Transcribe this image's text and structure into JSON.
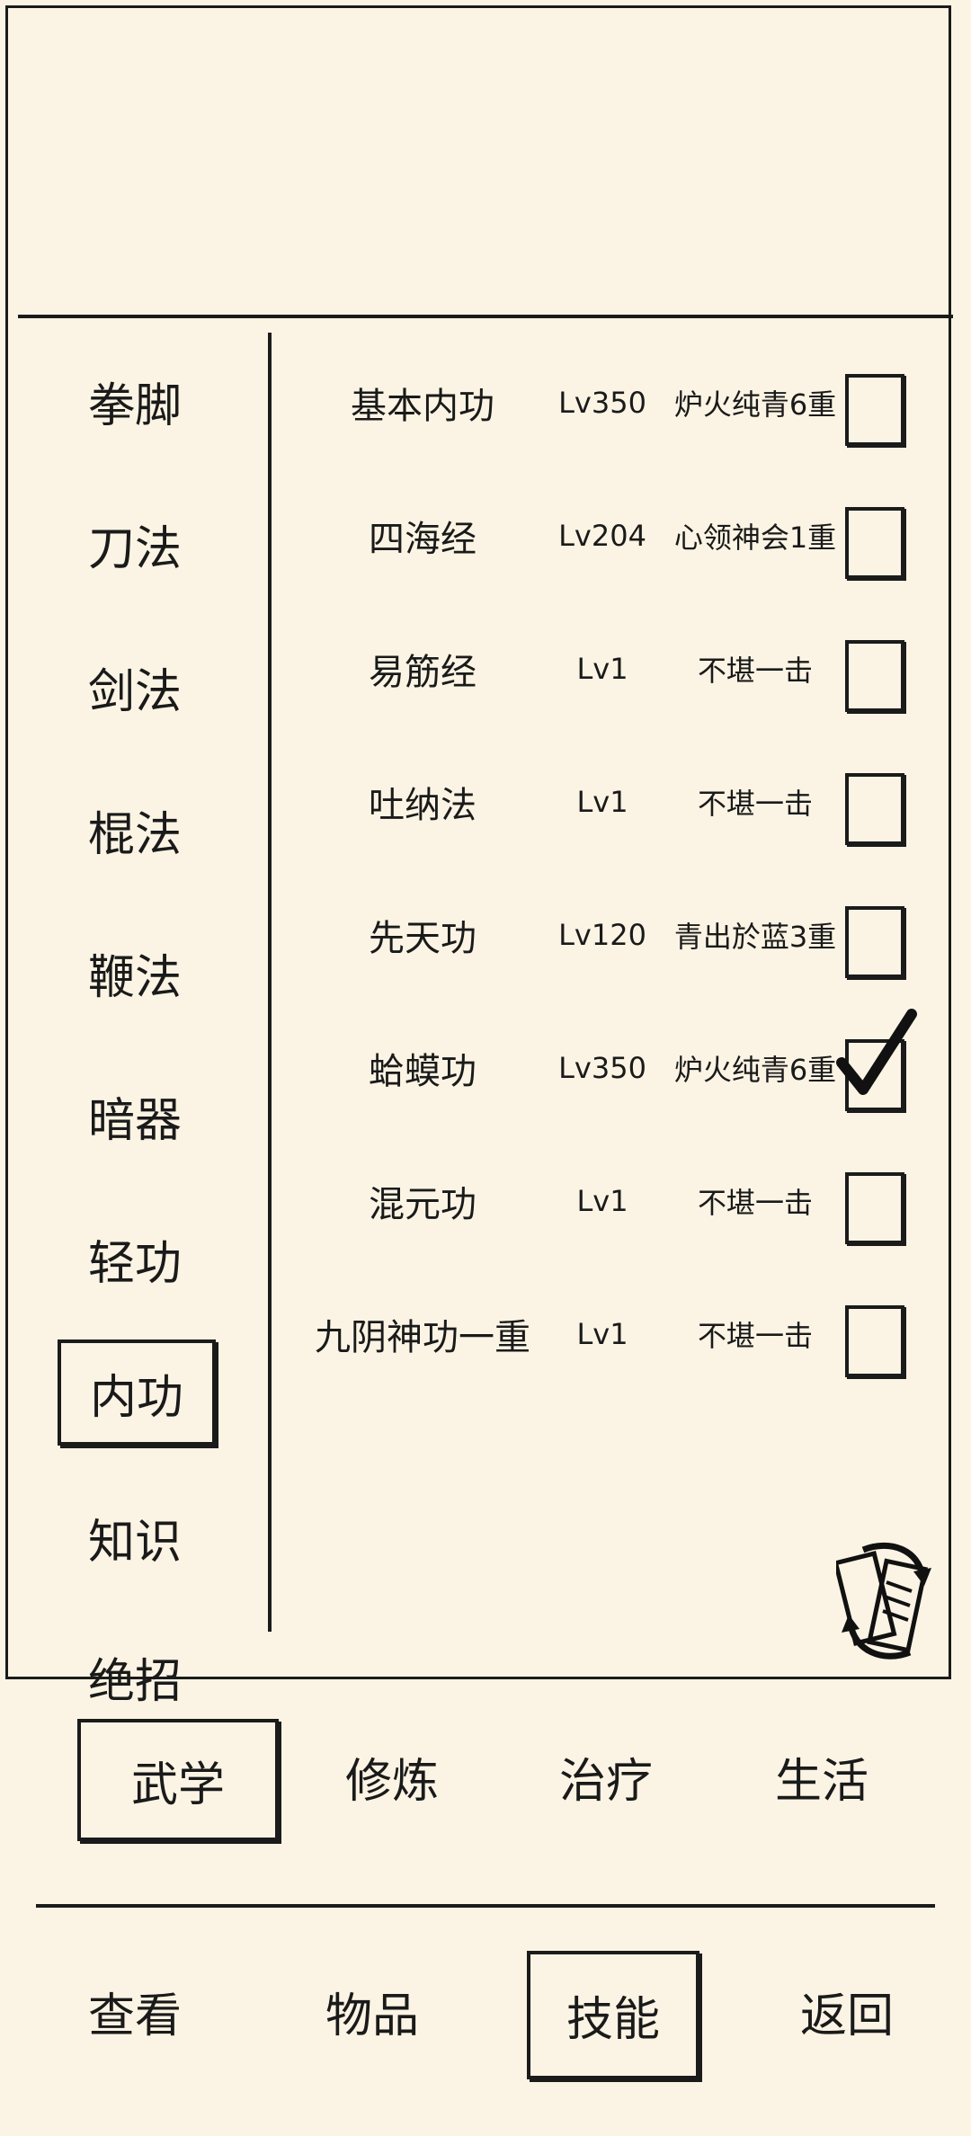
{
  "categories": [
    "拳脚",
    "刀法",
    "剑法",
    "棍法",
    "鞭法",
    "暗器",
    "轻功",
    "内功",
    "知识",
    "绝招"
  ],
  "selected_category": "内功",
  "skills": [
    {
      "name": "基本内功",
      "level": "Lv350",
      "status": "炉火纯青6重",
      "checked": false
    },
    {
      "name": "四海经",
      "level": "Lv204",
      "status": "心领神会1重",
      "checked": false
    },
    {
      "name": "易筋经",
      "level": "Lv1",
      "status": "不堪一击",
      "checked": false
    },
    {
      "name": "吐纳法",
      "level": "Lv1",
      "status": "不堪一击",
      "checked": false
    },
    {
      "name": "先天功",
      "level": "Lv120",
      "status": "青出於蓝3重",
      "checked": false
    },
    {
      "name": "蛤蟆功",
      "level": "Lv350",
      "status": "炉火纯青6重",
      "checked": true
    },
    {
      "name": "混元功",
      "level": "Lv1",
      "status": "不堪一击",
      "checked": false
    },
    {
      "name": "九阴神功一重",
      "level": "Lv1",
      "status": "不堪一击",
      "checked": false
    }
  ],
  "sub_tabs": [
    "武学",
    "修炼",
    "治疗",
    "生活"
  ],
  "selected_sub_tab": "武学",
  "nav": [
    "查看",
    "物品",
    "技能",
    "返回"
  ],
  "selected_nav": "技能",
  "icons": {
    "swap": "swap-cards-icon",
    "check": "checkmark-icon"
  }
}
